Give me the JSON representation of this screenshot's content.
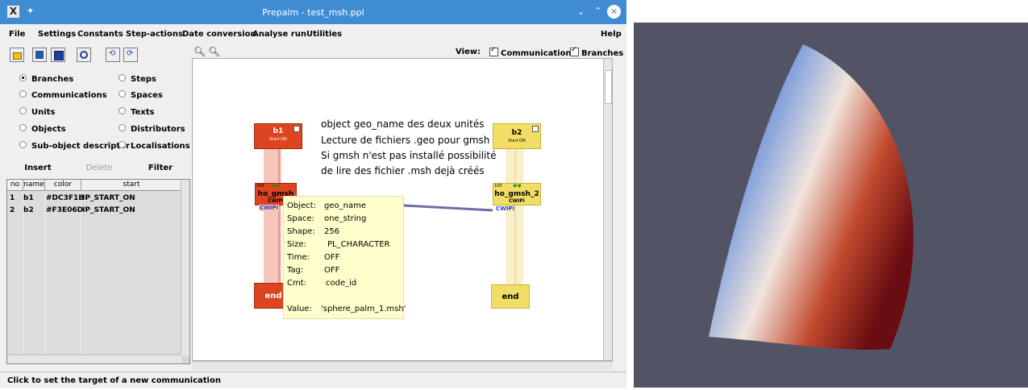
{
  "window": {
    "title": "Prepalm - test_msh.ppl",
    "logo": "X"
  },
  "menu": {
    "file": "File",
    "settings": "Settings",
    "constants": "Constants",
    "step_actions": "Step-actions",
    "date_conversion": "Date conversion",
    "analyse_run": "Analyse run",
    "utilities": "Utilities",
    "help": "Help"
  },
  "toolbar": {
    "view_label": "View:",
    "communications": "Communications",
    "branches": "Branches"
  },
  "radios": {
    "branches": "Branches",
    "steps": "Steps",
    "communications": "Communications",
    "spaces": "Spaces",
    "units": "Units",
    "texts": "Texts",
    "objects": "Objects",
    "distributors": "Distributors",
    "subobject": "Sub-object descriptor",
    "localisations": "Localisations",
    "selected": "Branches"
  },
  "buttons": {
    "insert": "Insert",
    "delete": "Delete",
    "filter": "Filter"
  },
  "table": {
    "headers": [
      "no",
      "name",
      "color",
      "start"
    ],
    "rows": [
      {
        "no": "1",
        "name": "b1",
        "color": "#DC3F1B",
        "start": "IP_START_ON"
      },
      {
        "no": "2",
        "name": "b2",
        "color": "#F3E06D",
        "start": "IP_START_ON"
      }
    ]
  },
  "canvas": {
    "b1": {
      "title": "b1",
      "sub": "Start ON",
      "color": "#DC3F1B"
    },
    "b2": {
      "title": "b2",
      "sub": "Start ON",
      "color": "#F3E06D"
    },
    "unit1": {
      "title": "ho_gmsh",
      "sub": "CWIPi",
      "badge": "100",
      "tag": "CWIPi"
    },
    "unit2": {
      "title": "ho_gmsh_2",
      "sub": "CWIPi",
      "badge": "100",
      "tag": "CWIPi"
    },
    "end1": "end",
    "end2": "end",
    "annotation": [
      "object geo_name des deux unités",
      "Lecture de fichiers .geo pour gmsh",
      "Si gmsh n'est pas installé possibilité",
      "de lire des fichier .msh dejà créés"
    ]
  },
  "tooltip": {
    "object_label": "Object:",
    "object": "geo_name",
    "space_label": "Space:",
    "space": "one_string",
    "shape_label": "Shape:",
    "shape": "256",
    "size_label": "Size:",
    "size": "PL_CHARACTER",
    "time_label": "Time:",
    "time": "OFF",
    "tag_label": "Tag:",
    "tag": "OFF",
    "cmt_label": "Cmt:",
    "cmt": "code_id",
    "value_label": "Value:",
    "value": "'sphere_palm_1.msh'"
  },
  "status": "Click to set the target of a new communication",
  "colors": {
    "titlebar": "#3f8cd3",
    "branch1": "#DC3F1B",
    "branch2": "#F3E06D",
    "viewport_bg": "#525466"
  }
}
